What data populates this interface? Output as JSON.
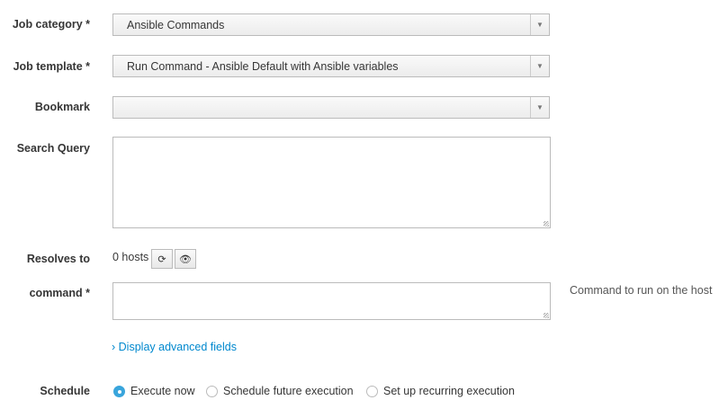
{
  "job_category": {
    "label": "Job category *",
    "value": "Ansible Commands"
  },
  "job_template": {
    "label": "Job template *",
    "value": "Run Command - Ansible Default with Ansible variables"
  },
  "bookmark": {
    "label": "Bookmark",
    "value": ""
  },
  "search_query": {
    "label": "Search Query",
    "value": ""
  },
  "resolves": {
    "label": "Resolves to",
    "value": "0 hosts"
  },
  "command": {
    "label": "command *",
    "value": "",
    "help": "Command to run on the host"
  },
  "advanced": {
    "chevron": "›",
    "label": "Display advanced fields"
  },
  "schedule": {
    "label": "Schedule",
    "options": [
      "Execute now",
      "Schedule future execution",
      "Set up recurring execution"
    ],
    "selected": "Execute now"
  },
  "colors": {
    "accent": "#39a5dc",
    "link": "#0088ce"
  }
}
